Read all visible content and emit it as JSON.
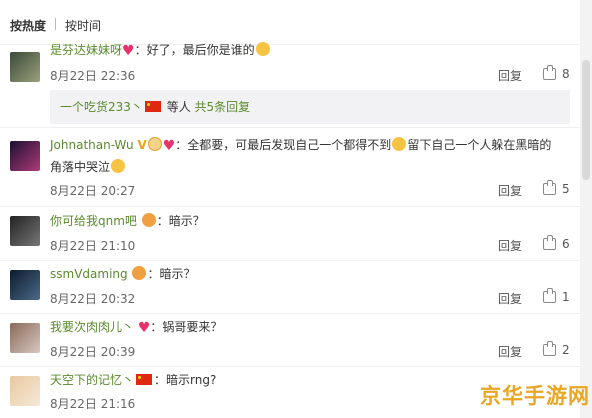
{
  "sort": {
    "hot": "按热度",
    "time": "按时间"
  },
  "reply_label": "回复",
  "comments": [
    {
      "user": "是芬达妹妹呀",
      "text": "：好了，最后你是谁的",
      "time": "8月22日 22:36",
      "likes": "8",
      "subreply": {
        "user": "一个吃货233丶",
        "mid": " 等人 ",
        "count": "共5条回复"
      }
    },
    {
      "user": "Johnathan-Wu",
      "text": "：全都要，可最后发现自己一个都得不到",
      "text2": "留下自己一个人躲在黑暗的",
      "text3": "角落中哭泣",
      "time": "8月22日 20:27",
      "likes": "5"
    },
    {
      "user": "你可给我qnm吧",
      "text": "：暗示？",
      "time": "8月22日 21:10",
      "likes": "6"
    },
    {
      "user": "ssmVdaming",
      "text": "：暗示？",
      "time": "8月22日 20:32",
      "likes": "1"
    },
    {
      "user": "我要次肉肉儿丶",
      "text": "：锅哥要来？",
      "time": "8月22日 20:39",
      "likes": "2"
    },
    {
      "user": "天空下的记忆丶",
      "text": "：暗示rng?",
      "time": "8月22日 21:16",
      "likes": ""
    }
  ],
  "watermark": "京华手游网",
  "colors": {
    "username": "#5a8a2e",
    "heart": "#e8326b",
    "watermark": "#e8a623"
  }
}
